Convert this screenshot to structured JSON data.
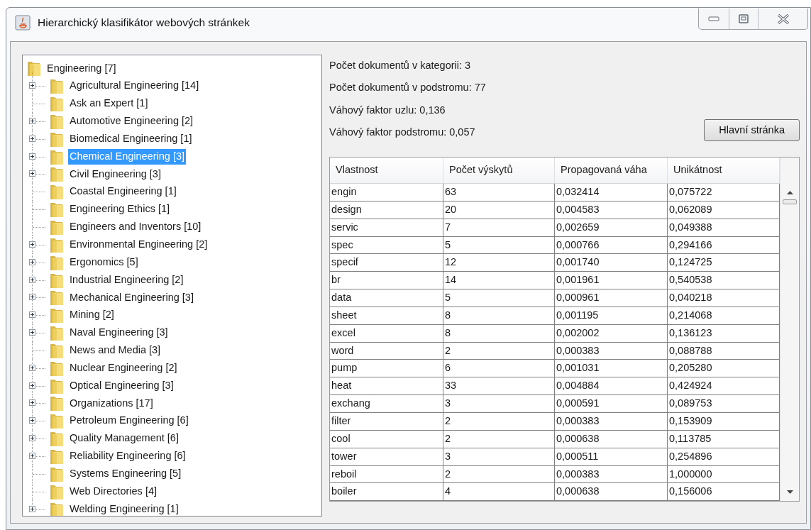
{
  "window": {
    "title": "Hierarchický klasifikátor webových stránkek"
  },
  "tree": {
    "label": "Engineering [7]",
    "selected": false,
    "children": [
      {
        "label": "Agricultural Engineering [14]",
        "expandable": true,
        "selected": false
      },
      {
        "label": "Ask an Expert [1]",
        "expandable": false,
        "selected": false
      },
      {
        "label": "Automotive Engineering [2]",
        "expandable": true,
        "selected": false
      },
      {
        "label": "Biomedical Engineering [1]",
        "expandable": true,
        "selected": false
      },
      {
        "label": "Chemical Engineering [3]",
        "expandable": true,
        "selected": true
      },
      {
        "label": "Civil Engineering [3]",
        "expandable": true,
        "selected": false
      },
      {
        "label": "Coastal Engineering [1]",
        "expandable": false,
        "selected": false
      },
      {
        "label": "Engineering Ethics [1]",
        "expandable": false,
        "selected": false
      },
      {
        "label": "Engineers and Inventors [10]",
        "expandable": false,
        "selected": false
      },
      {
        "label": "Environmental Engineering [2]",
        "expandable": true,
        "selected": false
      },
      {
        "label": "Ergonomics [5]",
        "expandable": true,
        "selected": false
      },
      {
        "label": "Industrial Engineering [2]",
        "expandable": true,
        "selected": false
      },
      {
        "label": "Mechanical Engineering [3]",
        "expandable": true,
        "selected": false
      },
      {
        "label": "Mining [2]",
        "expandable": true,
        "selected": false
      },
      {
        "label": "Naval Engineering [3]",
        "expandable": true,
        "selected": false
      },
      {
        "label": "News and Media [3]",
        "expandable": false,
        "selected": false
      },
      {
        "label": "Nuclear Engineering [2]",
        "expandable": true,
        "selected": false
      },
      {
        "label": "Optical Engineering [3]",
        "expandable": true,
        "selected": false
      },
      {
        "label": "Organizations [17]",
        "expandable": true,
        "selected": false
      },
      {
        "label": "Petroleum Engineering [6]",
        "expandable": true,
        "selected": false
      },
      {
        "label": "Quality Management [6]",
        "expandable": true,
        "selected": false
      },
      {
        "label": "Reliability Engineering [6]",
        "expandable": true,
        "selected": false
      },
      {
        "label": "Systems Engineering [5]",
        "expandable": false,
        "selected": false
      },
      {
        "label": "Web Directories [4]",
        "expandable": false,
        "selected": false
      },
      {
        "label": "Welding Engineering [1]",
        "expandable": true,
        "selected": false
      }
    ]
  },
  "info": [
    "Počet dokumentů v kategorii: 3",
    "Počet dokumentů v podstromu: 77",
    "Váhový faktor uzlu: 0,136",
    "Váhový faktor podstromu: 0,057"
  ],
  "main_page_button": "Hlavní stránka",
  "table": {
    "columns": [
      "Vlastnost",
      "Počet výskytů",
      "Propagovaná váha",
      "Unikátnost"
    ],
    "rows": [
      [
        "engin",
        "63",
        "0,032414",
        "0,075722"
      ],
      [
        "design",
        "20",
        "0,004583",
        "0,062089"
      ],
      [
        "servic",
        "7",
        "0,002659",
        "0,049388"
      ],
      [
        "spec",
        "5",
        "0,000766",
        "0,294166"
      ],
      [
        "specif",
        "12",
        "0,001740",
        "0,124725"
      ],
      [
        "br",
        "14",
        "0,001961",
        "0,540538"
      ],
      [
        "data",
        "5",
        "0,000961",
        "0,040218"
      ],
      [
        "sheet",
        "8",
        "0,001195",
        "0,214068"
      ],
      [
        "excel",
        "8",
        "0,002002",
        "0,136123"
      ],
      [
        "word",
        "2",
        "0,000383",
        "0,088788"
      ],
      [
        "pump",
        "6",
        "0,001031",
        "0,205280"
      ],
      [
        "heat",
        "33",
        "0,004884",
        "0,424924"
      ],
      [
        "exchang",
        "3",
        "0,000591",
        "0,089753"
      ],
      [
        "filter",
        "2",
        "0,000383",
        "0,153909"
      ],
      [
        "cool",
        "2",
        "0,000638",
        "0,113785"
      ],
      [
        "tower",
        "3",
        "0,000511",
        "0,254896"
      ],
      [
        "reboil",
        "2",
        "0,000383",
        "1,000000"
      ],
      [
        "boiler",
        "4",
        "0,000638",
        "0,156006"
      ]
    ]
  }
}
